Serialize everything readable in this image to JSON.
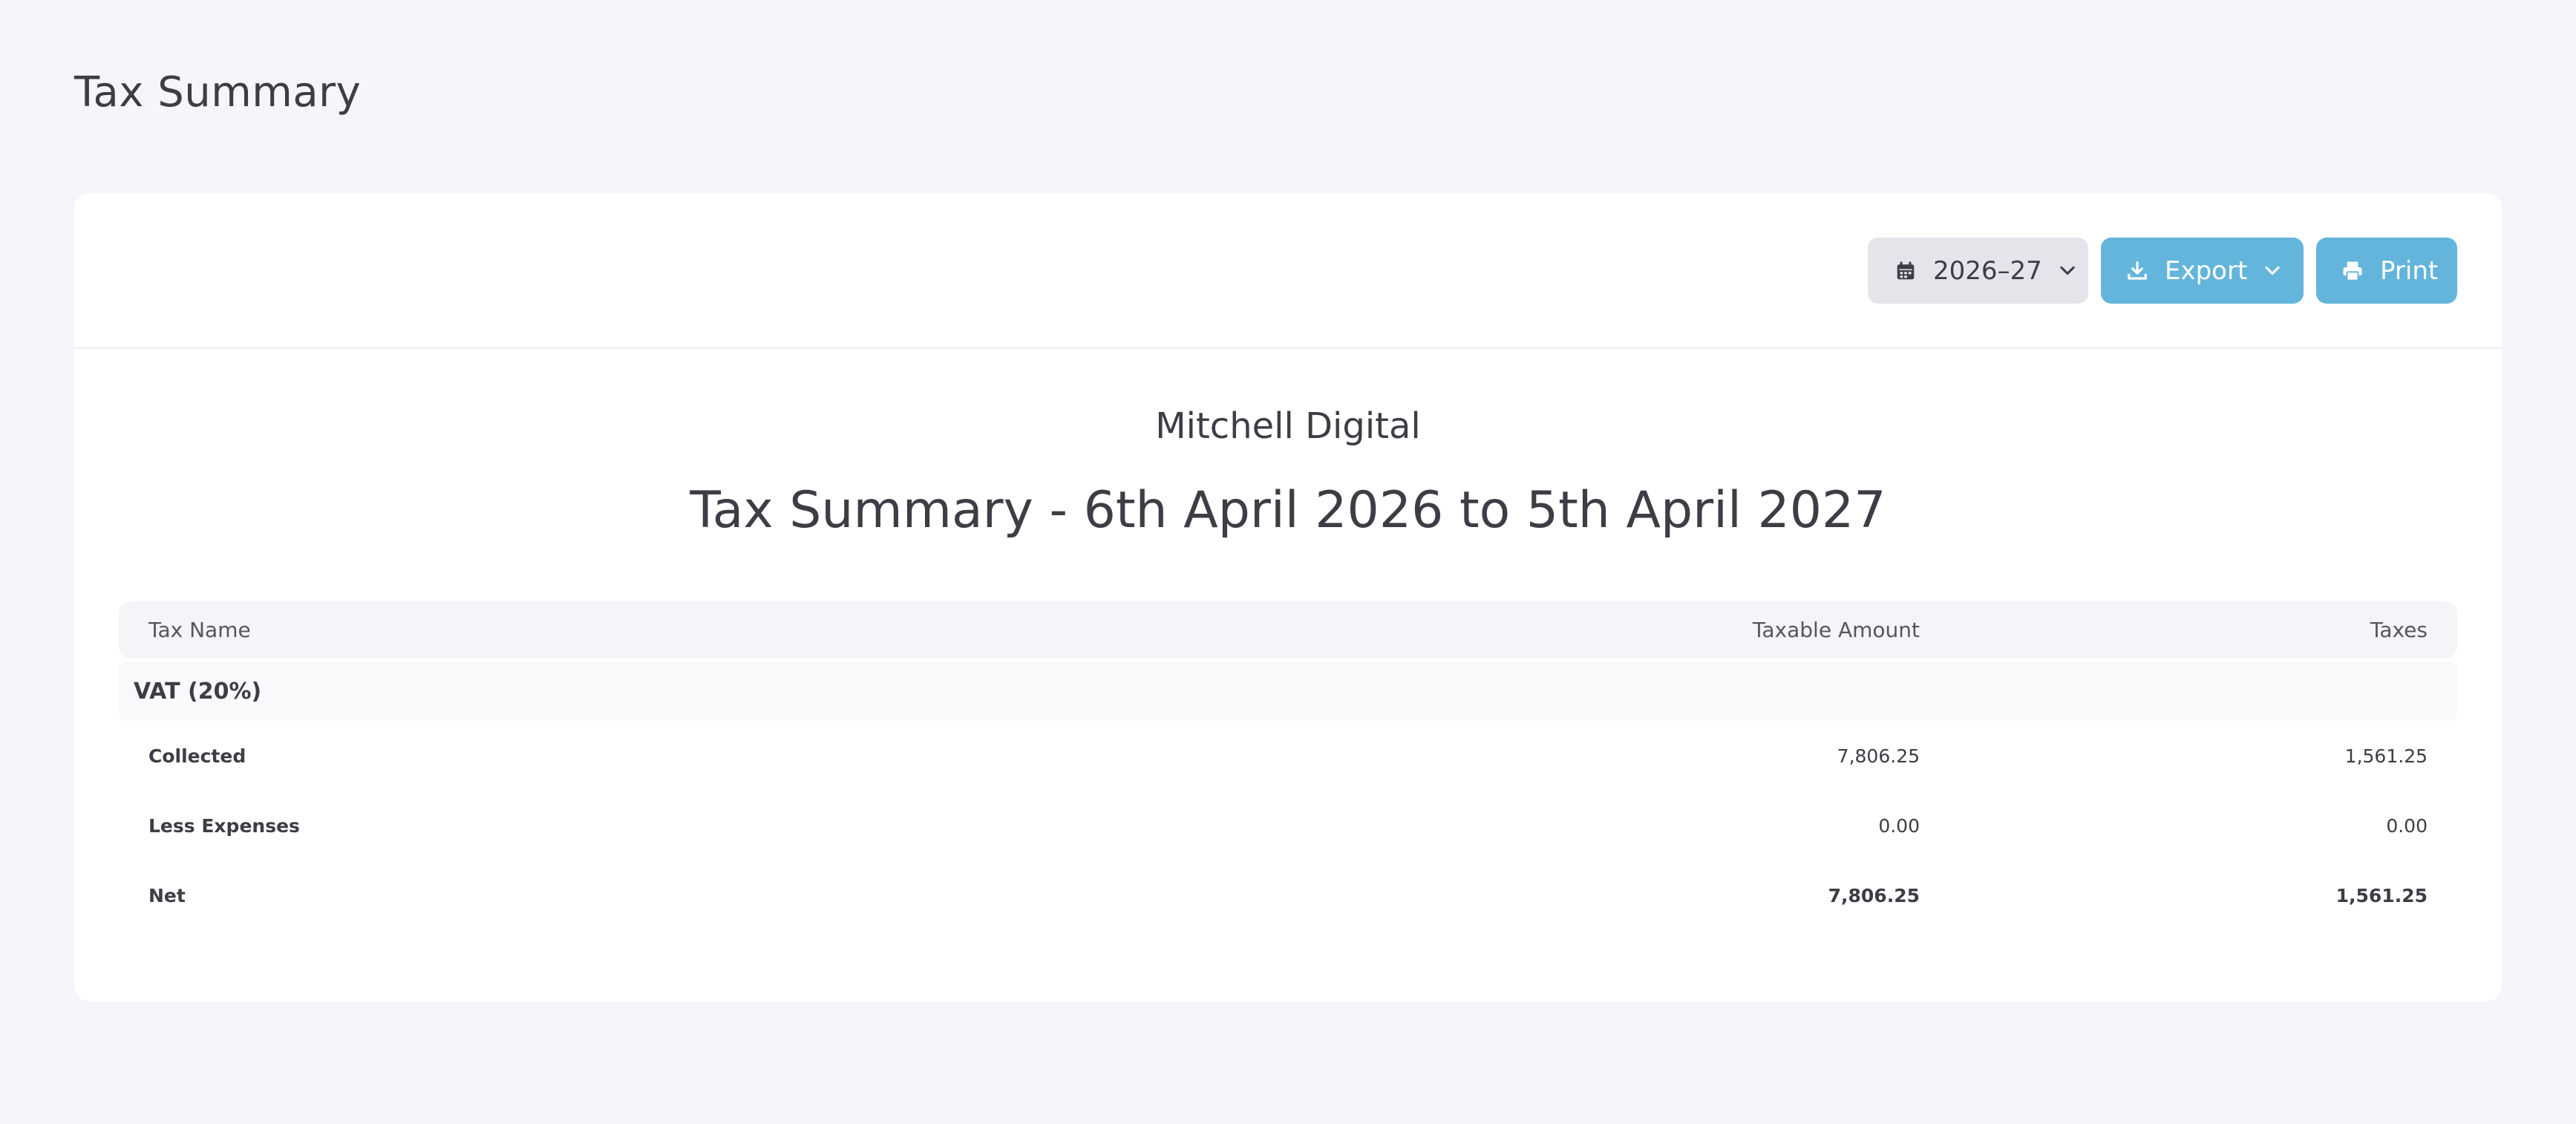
{
  "page": {
    "title": "Tax Summary"
  },
  "toolbar": {
    "year_label": "2026–27",
    "export_label": "Export",
    "print_label": "Print"
  },
  "report": {
    "company": "Mitchell Digital",
    "title": "Tax Summary - 6th April 2026 to 5th April 2027"
  },
  "table": {
    "headers": {
      "name": "Tax Name",
      "amount": "Taxable Amount",
      "taxes": "Taxes"
    },
    "group": "VAT (20%)",
    "rows": [
      {
        "name": "Collected",
        "amount": "7,806.25",
        "taxes": "1,561.25"
      },
      {
        "name": "Less Expenses",
        "amount": "0.00",
        "taxes": "0.00"
      },
      {
        "name": "Net",
        "amount": "7,806.25",
        "taxes": "1,561.25"
      }
    ]
  },
  "colors": {
    "accent": "#63b5db",
    "background": "#f5f6fa",
    "card": "#ffffff"
  },
  "icons": [
    "calendar-icon",
    "chevron-down-icon",
    "download-icon",
    "printer-icon"
  ]
}
